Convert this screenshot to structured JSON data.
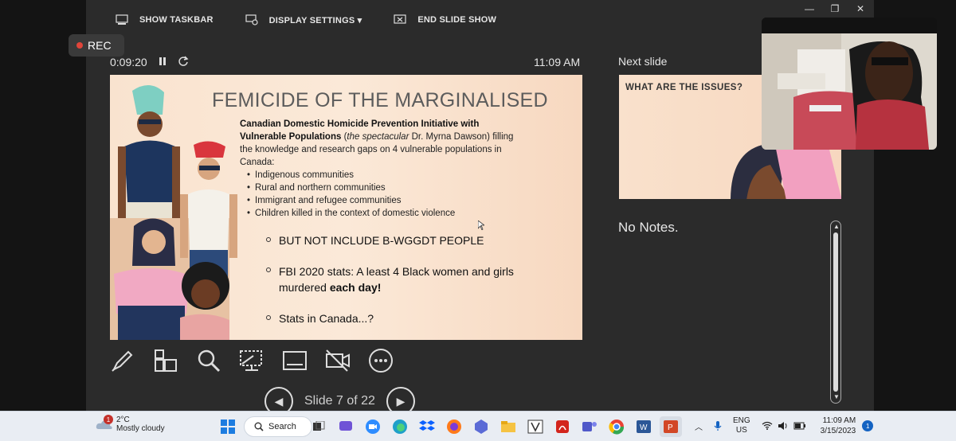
{
  "toolbar": {
    "show_taskbar": "SHOW TASKBAR",
    "display_settings": "DISPLAY SETTINGS ▾",
    "end_slide_show": "END SLIDE SHOW"
  },
  "recording": {
    "label": "REC"
  },
  "presenter": {
    "timer": "0:09:20",
    "clock": "11:09 AM",
    "next_slide_label": "Next slide",
    "notes": "No Notes.",
    "slide_counter": "Slide 7 of 22"
  },
  "slide": {
    "title": "FEMICIDE OF THE MARGINALISED",
    "para_bold1": "Canadian Domestic Homicide Prevention Initiative with Vulnerable Populations",
    "para_open": " (",
    "para_italic": "the spectacular",
    "para_rest": " Dr. Myrna Dawson) filling the knowledge and research gaps on 4 vulnerable populations in Canada:",
    "bullets": [
      "Indigenous communities",
      "Rural and northern communities",
      "Immigrant and refugee communities",
      "Children killed in the context of domestic violence"
    ],
    "sub_bullet1": "BUT NOT INCLUDE B-WGGDT PEOPLE",
    "sub_bullet2_text": "FBI 2020 stats: A least 4 Black women and girls murdered ",
    "sub_bullet2_bold": "each day!",
    "sub_bullet3": "Stats in Canada...?"
  },
  "next_slide": {
    "title": "WHAT ARE THE ISSUES?"
  },
  "taskbar": {
    "weather_temp": "2°C",
    "weather_desc": "Mostly cloudy",
    "weather_badge": "1",
    "search": "Search",
    "lang_line1": "ENG",
    "lang_line2": "US",
    "time": "11:09 AM",
    "date": "3/15/2023",
    "notif_count": "1"
  }
}
